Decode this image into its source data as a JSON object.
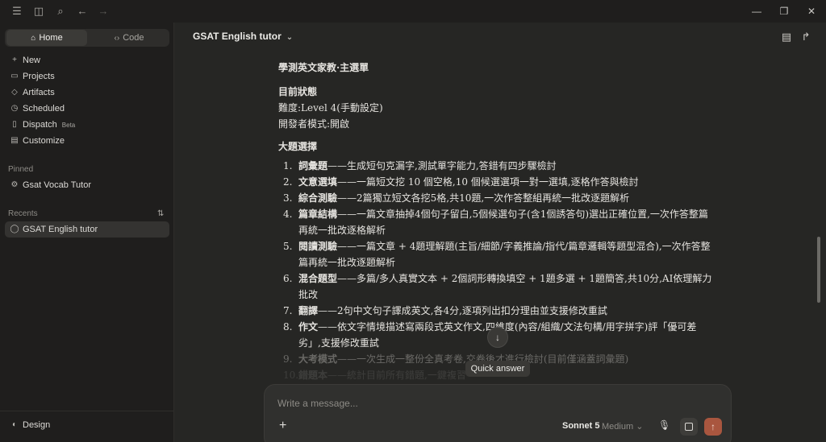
{
  "sidebar": {
    "tabs": [
      {
        "label": "Home",
        "icon": "home-icon"
      },
      {
        "label": "Code",
        "icon": "code-icon"
      }
    ],
    "nav": [
      {
        "label": "New",
        "icon": "plus-icon"
      },
      {
        "label": "Projects",
        "icon": "folder-icon"
      },
      {
        "label": "Artifacts",
        "icon": "artifacts-icon"
      },
      {
        "label": "Scheduled",
        "icon": "clock-icon"
      },
      {
        "label": "Dispatch",
        "icon": "dispatch-icon",
        "badge": "Beta"
      },
      {
        "label": "Customize",
        "icon": "briefcase-icon"
      }
    ],
    "pinned_label": "Pinned",
    "pinned": [
      {
        "label": "Gsat Vocab Tutor",
        "icon": "pinned-chat-icon"
      }
    ],
    "recents_label": "Recents",
    "recents": [
      {
        "label": "GSAT English tutor",
        "icon": "chat-icon"
      }
    ],
    "footer": {
      "label": "Design",
      "icon": "palette-icon"
    }
  },
  "header": {
    "title": "GSAT English tutor"
  },
  "document": {
    "heading": "學測英文家教·主選單",
    "status_heading": "目前狀態",
    "status_lines": [
      "難度:Level 4(手動設定)",
      "開發者模式:開啟"
    ],
    "menu_heading": "大題選擇",
    "items": [
      {
        "num": "1.",
        "title": "詞彙題",
        "desc": "——生成短句克漏字,測試單字能力,答錯有四步驟檢討"
      },
      {
        "num": "2.",
        "title": "文意選填",
        "desc": "——一篇短文挖 10 個空格,10 個候選選項一對一選填,逐格作答與檢討"
      },
      {
        "num": "3.",
        "title": "綜合測驗",
        "desc": "——2篇獨立短文各挖5格,共10題,一次作答整組再統一批改逐題解析"
      },
      {
        "num": "4.",
        "title": "篇章結構",
        "desc": "——一篇文章抽掉4個句子留白,5個候選句子(含1個誘答句)選出正確位置,一次作答整篇再統一批改逐格解析"
      },
      {
        "num": "5.",
        "title": "閱讀測驗",
        "desc": "——一篇文章 + 4題理解題(主旨/細節/字義推論/指代/篇章邏輯等題型混合),一次作答整篇再統一批改逐題解析"
      },
      {
        "num": "6.",
        "title": "混合題型",
        "desc": "——多篇/多人真實文本 + 2個詞形轉換填空 + 1題多選 + 1題簡答,共10分,AI依理解力批改"
      },
      {
        "num": "7.",
        "title": "翻譯",
        "desc": "——2句中文句子譯成英文,各4分,逐項列出扣分理由並支援修改重試"
      },
      {
        "num": "8.",
        "title": "作文",
        "desc": "——依文字情境描述寫兩段式英文作文,四維度(內容/組織/文法句構/用字拼字)評「優可差劣」,支援修改重試"
      },
      {
        "num": "9.",
        "title": "大考模式",
        "desc": "——一次生成一整份全真考卷,交卷後才進行檢討(目前僅涵蓋詞彙題)"
      },
      {
        "num": "10.",
        "title": "錯題本",
        "desc": "——統計目前所有錯題,一鍵複習"
      }
    ]
  },
  "tooltip": "Quick answer",
  "composer": {
    "placeholder": "Write a message...",
    "model": "Sonnet 5",
    "mode": "Medium"
  }
}
